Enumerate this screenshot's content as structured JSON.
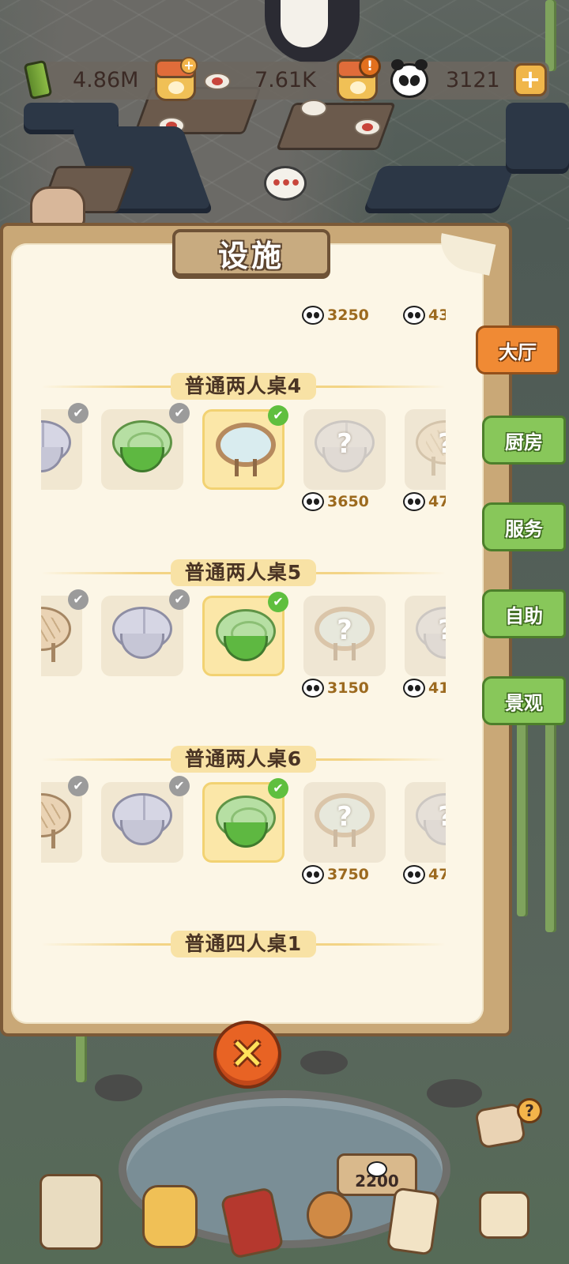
{
  "resources": {
    "bamboo_amount": "4.86M",
    "honey_amount": "7.61K",
    "panda_amount": "3121",
    "add_symbol": "+",
    "alert_symbol": "!"
  },
  "panel": {
    "title": "设施",
    "top_prices": [
      "3250",
      "43"
    ],
    "sections": [
      {
        "title": "普通两人桌4",
        "items": [
          {
            "style": "grey",
            "state": "owned"
          },
          {
            "style": "green",
            "state": "owned"
          },
          {
            "style": "glass",
            "state": "selected"
          },
          {
            "style": "grey",
            "state": "locked",
            "price": "3650"
          },
          {
            "style": "wood",
            "state": "locked",
            "price": "47"
          }
        ]
      },
      {
        "title": "普通两人桌5",
        "items": [
          {
            "style": "wood",
            "state": "owned"
          },
          {
            "style": "grey",
            "state": "owned"
          },
          {
            "style": "green",
            "state": "selected"
          },
          {
            "style": "glass",
            "state": "locked",
            "price": "3150"
          },
          {
            "style": "grey",
            "state": "locked",
            "price": "41"
          }
        ]
      },
      {
        "title": "普通两人桌6",
        "items": [
          {
            "style": "wood",
            "state": "owned"
          },
          {
            "style": "grey",
            "state": "owned"
          },
          {
            "style": "green",
            "state": "selected"
          },
          {
            "style": "glass",
            "state": "locked",
            "price": "3750"
          },
          {
            "style": "grey",
            "state": "locked",
            "price": "47"
          }
        ]
      },
      {
        "title": "普通四人桌1",
        "items": []
      }
    ],
    "check_symbol": "✔",
    "locked_symbol": "?"
  },
  "tabs": [
    {
      "label": "大厅",
      "active": true
    },
    {
      "label": "厨房",
      "active": false
    },
    {
      "label": "服务",
      "active": false
    },
    {
      "label": "自助",
      "active": false
    },
    {
      "label": "景观",
      "active": false
    }
  ],
  "close_symbol": "✕",
  "bottom": {
    "sign_value": "2200",
    "help_symbol": "?"
  },
  "colors": {
    "active_tab": "#f08a34",
    "inactive_tab": "#88c75a",
    "price_text": "#9c6a1f",
    "check_green": "#5fbf3e"
  }
}
